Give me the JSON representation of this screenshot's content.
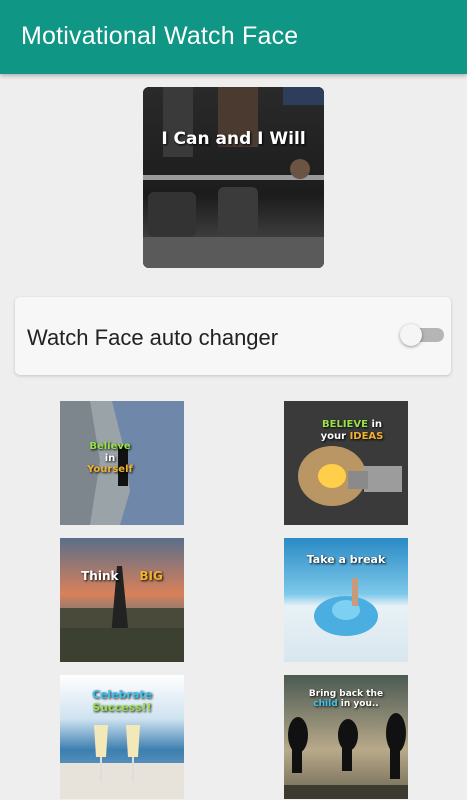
{
  "appbar": {
    "title": "Motivational Watch Face"
  },
  "hero": {
    "caption": "I Can and I Will"
  },
  "auto_changer": {
    "label": "Watch Face auto changer",
    "enabled": false
  },
  "faces": [
    {
      "line1": "Believe",
      "line2": "in",
      "line3": "Yourself"
    },
    {
      "line1": "BELIEVE",
      "line1b": "in",
      "line2": "your",
      "line2b": "IDEAS"
    },
    {
      "line1": "Think",
      "line1b": "BIG"
    },
    {
      "line1": "Take a break"
    },
    {
      "line1": "Celebrate",
      "line2": "Success!!"
    },
    {
      "line1": "Bring back the",
      "line2": "child",
      "line2b": "in you.."
    }
  ],
  "colors": {
    "primary": "#0f9684",
    "background": "#eeeeee"
  }
}
